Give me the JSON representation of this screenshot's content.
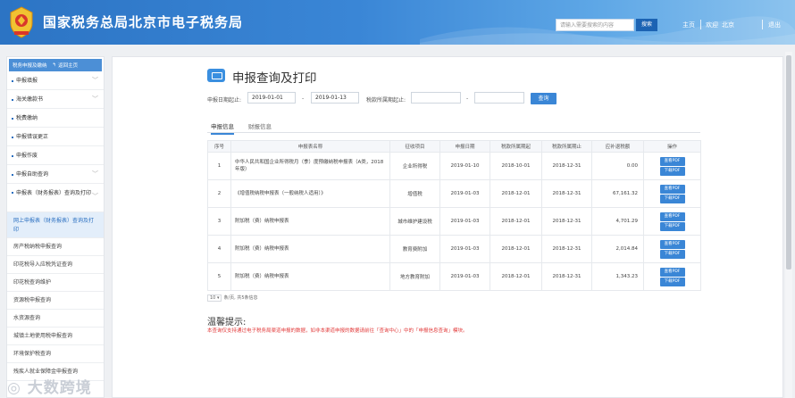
{
  "header": {
    "title": "国家税务总局北京市电子税务局",
    "search_placeholder": "请输入需要搜索的内容",
    "search_button": "搜索",
    "links": [
      "主页",
      "欢迎",
      "北京",
      "退出"
    ]
  },
  "sidebar": {
    "head_label": "税务申报及缴纳",
    "head_back": "返回主页",
    "items": [
      {
        "label": "申报填报",
        "chevron": "﹀"
      },
      {
        "label": "海关缴款书",
        "chevron": "﹀"
      },
      {
        "label": "税费缴纳",
        "chevron": ""
      },
      {
        "label": "申报错误更正",
        "chevron": ""
      },
      {
        "label": "申报作废",
        "chevron": ""
      },
      {
        "label": "申报自助查询",
        "chevron": "﹀"
      },
      {
        "label": "申报表（财务报表）查询及打印",
        "chevron": "﹀"
      }
    ],
    "subitems": [
      "网上申报表（财务报表）查询及打印",
      "房产税纳税申报查询",
      "印花税导入应税凭证查询",
      "印花税查询维护",
      "资源税申报查询",
      "水资源查询",
      "城镇土地使用税申报查询",
      "环境保护税查询",
      "残疾人就业保障金申报查询"
    ]
  },
  "page": {
    "title": "申报查询及打印",
    "filters": {
      "date_label": "申报日期起止:",
      "date_from": "2019-01-01",
      "date_sep": "-",
      "date_to": "2019-01-13",
      "period_label": "税款所属期起止:",
      "period_from": "",
      "period_sep": "-",
      "period_to": "",
      "query_button": "查询"
    },
    "tabs": [
      "申报信息",
      "财报信息"
    ],
    "table": {
      "headers": [
        "序号",
        "申报表名称",
        "征收项目",
        "申报日期",
        "税款所属期起",
        "税款所属期止",
        "应补退税额",
        "操作"
      ],
      "rows": [
        {
          "no": "1",
          "name": "中华人民共和国企业所得税月（季）度预缴纳税申报表（A类，2018年版）",
          "item": "企业所得税",
          "date": "2019-01-10",
          "from": "2018-10-01",
          "to": "2018-12-31",
          "amount": "0.00"
        },
        {
          "no": "2",
          "name": "《增值税纳税申报表（一般纳税人适用）》",
          "item": "增值税",
          "date": "2019-01-03",
          "from": "2018-12-01",
          "to": "2018-12-31",
          "amount": "67,161.32"
        },
        {
          "no": "3",
          "name": "附加税（费）纳税申报表",
          "item": "城市维护建设税",
          "date": "2019-01-03",
          "from": "2018-12-01",
          "to": "2018-12-31",
          "amount": "4,701.29"
        },
        {
          "no": "4",
          "name": "附加税（费）纳税申报表",
          "item": "教育费附加",
          "date": "2019-01-03",
          "from": "2018-12-01",
          "to": "2018-12-31",
          "amount": "2,014.84"
        },
        {
          "no": "5",
          "name": "附加税（费）纳税申报表",
          "item": "地方教育附加",
          "date": "2019-01-03",
          "from": "2018-12-01",
          "to": "2018-12-31",
          "amount": "1,343.23"
        }
      ],
      "op_view": "查看PDF",
      "op_download": "下载PDF"
    },
    "pager": {
      "size": "10",
      "text": "条/页, 共5条信息"
    },
    "tip_title": "温馨提示:",
    "tip_text": "本查询仅支持通过电子税务局渠道申报的数据，如非本渠道申报的数据请前往「查询中心」中的「申报信息查询」模块。"
  },
  "watermark": "大数跨境"
}
